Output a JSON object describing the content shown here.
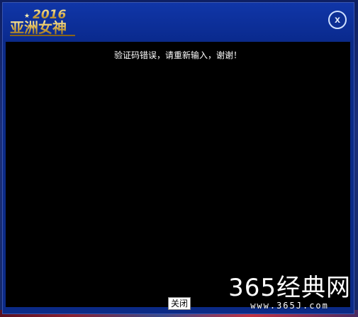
{
  "dialog": {
    "logo_year": "2016",
    "logo_text": "亚洲女神",
    "close_icon_glyph": "x",
    "message": "验证码错误，请重新输入，谢谢！",
    "close_button_label": "关闭"
  },
  "watermark": {
    "main": "365经典网",
    "url": "www.365J.com"
  },
  "colors": {
    "dialog_blue": "#0b2a86",
    "content_black": "#000000",
    "logo_gold": "#d8b04a"
  }
}
